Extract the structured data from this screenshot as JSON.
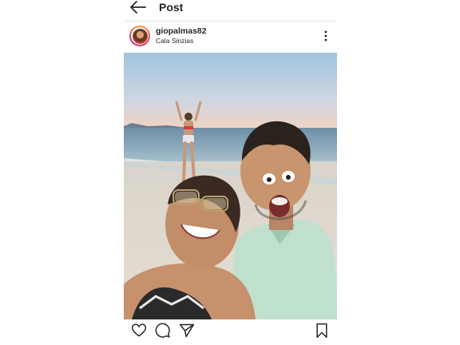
{
  "header": {
    "title": "Post"
  },
  "post": {
    "username": "giopalmas82",
    "location": "Cala Sinzias"
  },
  "icons": {
    "back": "arrow-left-icon",
    "more": "more-vertical-icon",
    "like": "heart-icon",
    "comment": "comment-icon",
    "share": "send-icon",
    "save": "bookmark-icon"
  },
  "colors": {
    "text": "#262626",
    "divider": "#e6e6e6"
  }
}
